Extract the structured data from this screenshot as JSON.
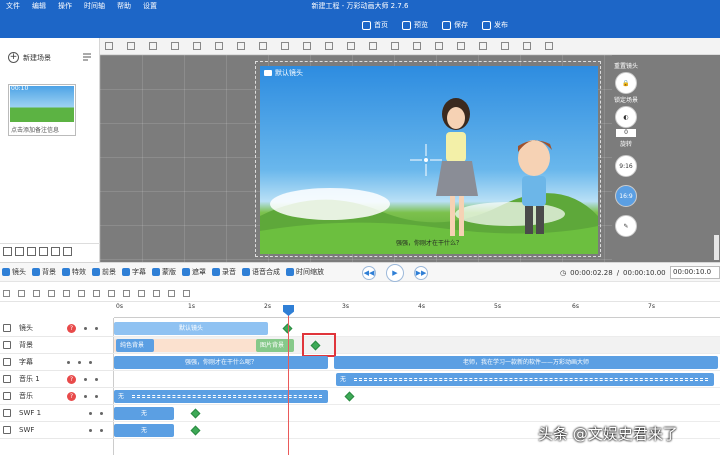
{
  "titlebar": {
    "menu": [
      "文件",
      "编辑",
      "操作",
      "时间轴",
      "帮助",
      "设置"
    ],
    "title": "新建工程 - 万彩动画大师 2.7.6",
    "actions": [
      "首页",
      "预览",
      "保存",
      "发布"
    ]
  },
  "left_panel": {
    "new_scene": "新建场景",
    "scene_duration": "00:10",
    "scene_note": "点击添加备注信息"
  },
  "canvas": {
    "camera_label": "默认镜头",
    "subtitle": "强强，你刚才在干什么？"
  },
  "right_controls": {
    "reset_camera": "重置镜头",
    "lock_scene": "锁定场景",
    "rotation_value": "0",
    "rotate": "旋转",
    "ratio_916": "9:16",
    "ratio_169": "16:9"
  },
  "toolbar": {
    "items": [
      "镜头",
      "背景",
      "特效",
      "前景",
      "字幕",
      "蒙版",
      "遮罩",
      "录音",
      "语音合成",
      "时间缩放"
    ],
    "time_current": "00:00:02.28",
    "time_total": "00:00:10.00",
    "time_field": "00:00:10.0"
  },
  "ruler": {
    "ticks": [
      "0s",
      "1s",
      "2s",
      "3s",
      "4s",
      "5s",
      "6s",
      "7s"
    ]
  },
  "tracks": {
    "names": [
      "镜头",
      "背景",
      "字幕",
      "音乐 1",
      "音乐",
      "SWF 1",
      "SWF"
    ],
    "camera_clip": "默认镜头",
    "bg_clip_1": "纯色背景",
    "bg_clip_2": "图片背景",
    "subtitle_clip_1": "强强，你刚才在干什么呢？",
    "subtitle_clip_2": "老师，我在学习一款新的软件——万彩动画大师",
    "audio_none": "无",
    "swf_none": "无"
  },
  "watermark": "头条 @文娱史君来了",
  "colors": {
    "titlebar": "#1d66c7",
    "clip": "#5b9fe3",
    "keyframe": "#3eaa57",
    "playhead": "#2f7fd6",
    "highlight": "#e0353b"
  }
}
